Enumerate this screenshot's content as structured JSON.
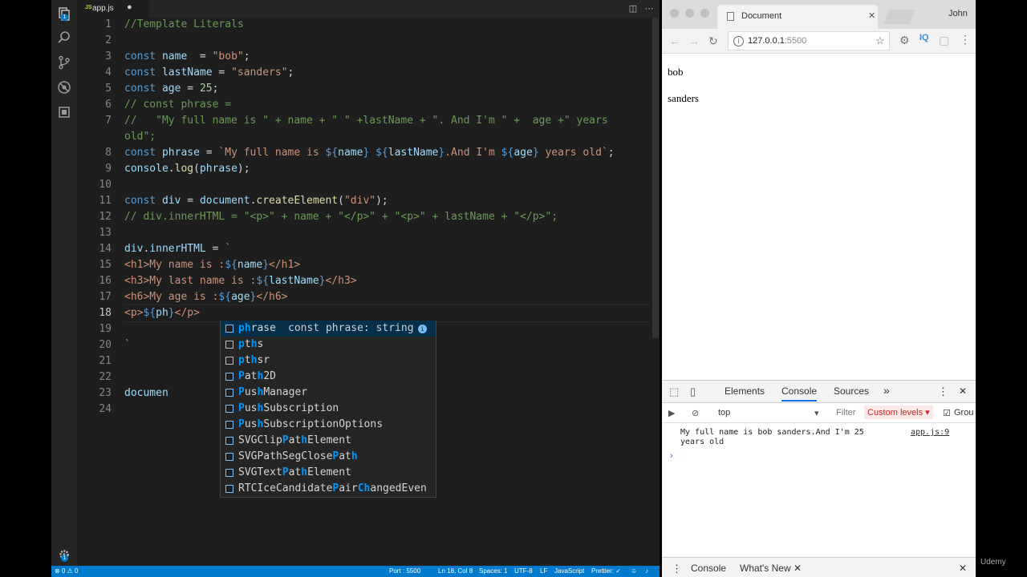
{
  "editor": {
    "tab_label": "app.js",
    "tab_icon": "JS",
    "modified_marker": "●",
    "lines": [
      {
        "n": "1",
        "parts": [
          [
            "cm",
            "//Template Literals"
          ]
        ]
      },
      {
        "n": "2",
        "parts": []
      },
      {
        "n": "3",
        "parts": [
          [
            "kw",
            "const "
          ],
          [
            "var",
            "name"
          ],
          [
            "",
            "  = "
          ],
          [
            "str",
            "\"bob\""
          ],
          [
            "",
            ";"
          ]
        ]
      },
      {
        "n": "4",
        "parts": [
          [
            "kw",
            "const "
          ],
          [
            "var",
            "lastName"
          ],
          [
            "",
            " = "
          ],
          [
            "str",
            "\"sanders\""
          ],
          [
            "",
            ";"
          ]
        ]
      },
      {
        "n": "5",
        "parts": [
          [
            "kw",
            "const "
          ],
          [
            "var",
            "age"
          ],
          [
            "",
            " = "
          ],
          [
            "num",
            "25"
          ],
          [
            "",
            ";"
          ]
        ]
      },
      {
        "n": "6",
        "parts": [
          [
            "cm",
            "// const phrase ="
          ]
        ]
      },
      {
        "n": "7",
        "parts": [
          [
            "cm",
            "//   \"My full name is \" + name + \" \" +lastName + \". And I'm \" +  age +\" years"
          ]
        ]
      },
      {
        "n": "",
        "parts": [
          [
            "cm",
            "old\";"
          ]
        ]
      },
      {
        "n": "8",
        "parts": [
          [
            "kw",
            "const "
          ],
          [
            "var",
            "phrase"
          ],
          [
            "",
            " = "
          ],
          [
            "str",
            "`My full name is "
          ],
          [
            "tmpl",
            "${"
          ],
          [
            "var",
            "name"
          ],
          [
            "tmpl",
            "}"
          ],
          [
            "str",
            " "
          ],
          [
            "tmpl",
            "${"
          ],
          [
            "var",
            "lastName"
          ],
          [
            "tmpl",
            "}"
          ],
          [
            "str",
            ".And I'm "
          ],
          [
            "tmpl",
            "${"
          ],
          [
            "var",
            "age"
          ],
          [
            "tmpl",
            "}"
          ],
          [
            "str",
            " years old`"
          ],
          [
            "",
            ";"
          ]
        ]
      },
      {
        "n": "9",
        "parts": [
          [
            "var",
            "console"
          ],
          [
            "",
            "."
          ],
          [
            "fn",
            "log"
          ],
          [
            "",
            "("
          ],
          [
            "var",
            "phrase"
          ],
          [
            "",
            ");"
          ]
        ]
      },
      {
        "n": "10",
        "parts": []
      },
      {
        "n": "11",
        "parts": [
          [
            "kw",
            "const "
          ],
          [
            "var",
            "div"
          ],
          [
            "",
            " = "
          ],
          [
            "var",
            "document"
          ],
          [
            "",
            "."
          ],
          [
            "fn",
            "createElement"
          ],
          [
            "",
            "("
          ],
          [
            "str",
            "\"div\""
          ],
          [
            "",
            ");"
          ]
        ]
      },
      {
        "n": "12",
        "parts": [
          [
            "cm",
            "// div.innerHTML = \"<p>\" + name + \"</p>\" + \"<p>\" + lastName + \"</p>\";"
          ]
        ]
      },
      {
        "n": "13",
        "parts": []
      },
      {
        "n": "14",
        "parts": [
          [
            "var",
            "div"
          ],
          [
            "",
            "."
          ],
          [
            "var",
            "innerHTML"
          ],
          [
            "",
            " = "
          ],
          [
            "str",
            "`"
          ]
        ]
      },
      {
        "n": "15",
        "parts": [
          [
            "str",
            "<h1>My name is :"
          ],
          [
            "tmpl",
            "${"
          ],
          [
            "var",
            "name"
          ],
          [
            "tmpl",
            "}"
          ],
          [
            "str",
            "</h1>"
          ]
        ]
      },
      {
        "n": "16",
        "parts": [
          [
            "str",
            "<h3>My last name is :"
          ],
          [
            "tmpl",
            "${"
          ],
          [
            "var",
            "lastName"
          ],
          [
            "tmpl",
            "}"
          ],
          [
            "str",
            "</h3>"
          ]
        ]
      },
      {
        "n": "17",
        "parts": [
          [
            "str",
            "<h6>My age is :"
          ],
          [
            "tmpl",
            "${"
          ],
          [
            "var",
            "age"
          ],
          [
            "tmpl",
            "}"
          ],
          [
            "str",
            "</h6>"
          ]
        ]
      },
      {
        "n": "18",
        "parts": [
          [
            "str",
            "<p>"
          ],
          [
            "tmpl",
            "${"
          ],
          [
            "var",
            "ph"
          ],
          [
            "tmpl",
            "}"
          ],
          [
            "str",
            "</p>"
          ]
        ]
      },
      {
        "n": "19",
        "parts": []
      },
      {
        "n": "20",
        "parts": [
          [
            "str",
            "`"
          ]
        ]
      },
      {
        "n": "21",
        "parts": []
      },
      {
        "n": "22",
        "parts": []
      },
      {
        "n": "23",
        "parts": [
          [
            "var",
            "documen"
          ]
        ]
      },
      {
        "n": "24",
        "parts": []
      }
    ]
  },
  "suggestions": [
    {
      "kind": "var",
      "label": [
        [
          "hl",
          "ph"
        ],
        [
          "",
          "rase"
        ]
      ],
      "detail": "const phrase: string",
      "selected": true
    },
    {
      "kind": "word",
      "label": [
        [
          "hl",
          "p"
        ],
        [
          "",
          "t"
        ],
        [
          "hl",
          "h"
        ],
        [
          "",
          "s"
        ]
      ]
    },
    {
      "kind": "word",
      "label": [
        [
          "hl",
          "p"
        ],
        [
          "",
          "t"
        ],
        [
          "hl",
          "h"
        ],
        [
          "",
          "sr"
        ]
      ]
    },
    {
      "kind": "cls",
      "label": [
        [
          "hl",
          "P"
        ],
        [
          "",
          "at"
        ],
        [
          "hl",
          "h"
        ],
        [
          "",
          "2D"
        ]
      ]
    },
    {
      "kind": "cls",
      "label": [
        [
          "hl",
          "P"
        ],
        [
          "",
          "us"
        ],
        [
          "hl",
          "h"
        ],
        [
          "",
          "Manager"
        ]
      ]
    },
    {
      "kind": "cls",
      "label": [
        [
          "hl",
          "P"
        ],
        [
          "",
          "us"
        ],
        [
          "hl",
          "h"
        ],
        [
          "",
          "Subscription"
        ]
      ]
    },
    {
      "kind": "cls",
      "label": [
        [
          "hl",
          "P"
        ],
        [
          "",
          "us"
        ],
        [
          "hl",
          "h"
        ],
        [
          "",
          "SubscriptionOptions"
        ]
      ]
    },
    {
      "kind": "cls",
      "label": [
        [
          "",
          "SVGClip"
        ],
        [
          "hl",
          "P"
        ],
        [
          "",
          "at"
        ],
        [
          "hl",
          "h"
        ],
        [
          "",
          "Element"
        ]
      ]
    },
    {
      "kind": "cls",
      "label": [
        [
          "",
          "SVGPathSegClose"
        ],
        [
          "hl",
          "P"
        ],
        [
          "",
          "at"
        ],
        [
          "hl",
          "h"
        ]
      ]
    },
    {
      "kind": "cls",
      "label": [
        [
          "",
          "SVGText"
        ],
        [
          "hl",
          "P"
        ],
        [
          "",
          "at"
        ],
        [
          "hl",
          "h"
        ],
        [
          "",
          "Element"
        ]
      ]
    },
    {
      "kind": "cls",
      "label": [
        [
          "",
          "RTCIceCandidate"
        ],
        [
          "hl",
          "P"
        ],
        [
          "",
          "air"
        ],
        [
          "hl",
          "Ch"
        ],
        [
          "",
          "angedEven"
        ]
      ]
    }
  ],
  "statusbar": {
    "problems": "⊗ 0 ⚠ 0",
    "port": "Port : 5500",
    "cursor": "Ln 18, Col 8",
    "spaces": "Spaces: 1",
    "encoding": "UTF-8",
    "eol": "LF",
    "language": "JavaScript",
    "formatter": "Prettier: ✓"
  },
  "browser": {
    "tab_title": "Document",
    "user": "John",
    "url_host": "127.0.0.1",
    "url_port": ":5500",
    "ext_label": "IQ",
    "page_lines": [
      "bob",
      "sanders"
    ]
  },
  "devtools": {
    "tabs": [
      "Elements",
      "Console",
      "Sources"
    ],
    "more": "»",
    "context": "top",
    "filter_placeholder": "Filter",
    "levels": "Custom levels ▾",
    "group_label": "Grou",
    "log_message": "My full name is bob sanders.And I'm 25 years old",
    "log_source": "app.js:9",
    "prompt": "›",
    "drawer_tabs": [
      "Console",
      "What's New"
    ]
  },
  "watermark": "Udemy"
}
